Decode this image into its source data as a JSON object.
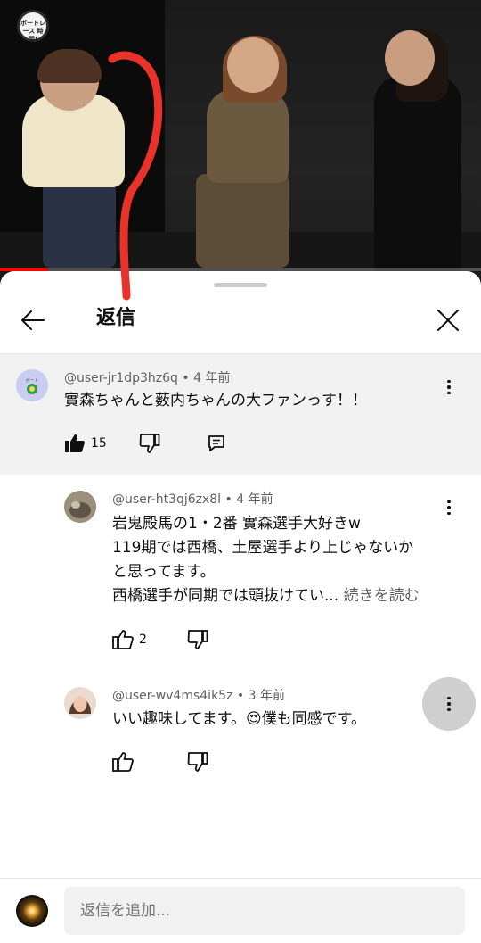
{
  "video": {
    "channel_logo_text": "ボートレース 時間!",
    "progress_fraction": 0.1
  },
  "sheet": {
    "title": "返信"
  },
  "comments": [
    {
      "handle": "@user-jr1dp3hz6q",
      "time": "4 年前",
      "text": "實森ちゃんと薮内ちゃんの大ファンっす！！",
      "likes": "15"
    },
    {
      "handle": "@user-ht3qj6zx8l",
      "time": "4 年前",
      "lines": [
        "岩鬼殿馬の1・2番 實森選手大好きw",
        "119期では西橋、土屋選手より上じゃないか",
        "と思ってます。",
        "西橋選手が同期では頭抜けてい..."
      ],
      "read_more": "続きを読む",
      "likes": "2"
    },
    {
      "handle": "@user-wv4ms4ik5z",
      "time": "3 年前",
      "text_before_emoji": "いい趣味してます。",
      "emoji": "😍",
      "text_after_emoji": "僕も同感です。"
    }
  ],
  "meta_separator": " • ",
  "composer": {
    "placeholder": "返信を追加..."
  },
  "colors": {
    "accent_red": "#ff0000",
    "annotation_red": "#e8322a",
    "parent_bg": "#f2f2f2",
    "secondary_text": "#606060"
  },
  "icons": [
    "back-arrow-icon",
    "close-icon",
    "more-vert-icon",
    "like-icon",
    "dislike-icon",
    "reply-icon"
  ]
}
